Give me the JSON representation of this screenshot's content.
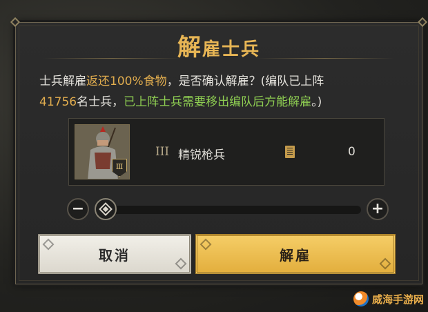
{
  "dialog": {
    "title_first": "解",
    "title_rest": "雇士兵",
    "desc_part1": "士兵解雇",
    "desc_highlight": "返还100%食物",
    "desc_part2": "，是否确认解雇？(编队已上阵",
    "desc_count": "41756",
    "desc_part3": "名士兵，",
    "desc_warning": "已上阵士兵需要移出编队后方能解雇",
    "desc_end": "。)"
  },
  "unit": {
    "tier": "III",
    "name": "精锐枪兵",
    "count": "0",
    "icon": "document-icon"
  },
  "slider": {
    "minus_label": "−",
    "plus_label": "+",
    "value_fraction": 0
  },
  "buttons": {
    "cancel_label": "取消",
    "confirm_label": "解雇"
  },
  "watermark": {
    "text": "威海手游网"
  },
  "colors": {
    "title": "#e8b655",
    "highlight": "#e0ac4e",
    "warning": "#8fcf52",
    "confirm_button": "#f0c255",
    "cancel_button": "#ebe8e0"
  }
}
